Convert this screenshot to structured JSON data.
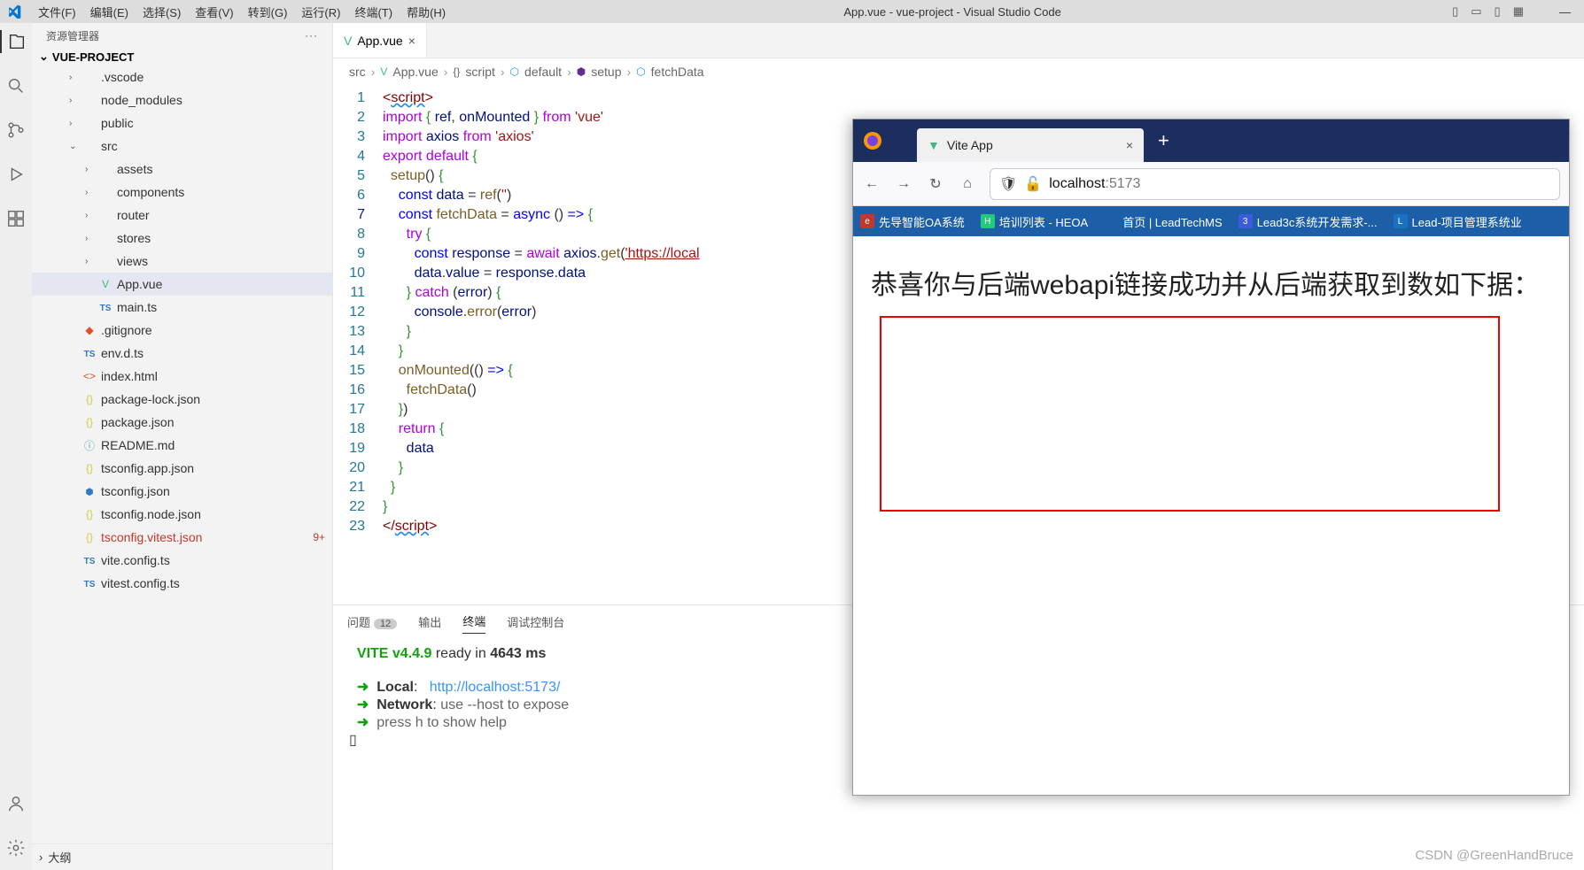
{
  "menubar": {
    "items": [
      "文件(F)",
      "编辑(E)",
      "选择(S)",
      "查看(V)",
      "转到(G)",
      "运行(R)",
      "终端(T)",
      "帮助(H)"
    ],
    "title": "App.vue - vue-project - Visual Studio Code"
  },
  "sidebar": {
    "header": "资源管理器",
    "project": "VUE-PROJECT",
    "outline": "大纲",
    "items": [
      {
        "type": "folder",
        "depth": 1,
        "name": ".vscode",
        "open": false
      },
      {
        "type": "folder",
        "depth": 1,
        "name": "node_modules",
        "open": false
      },
      {
        "type": "folder",
        "depth": 1,
        "name": "public",
        "open": false
      },
      {
        "type": "folder",
        "depth": 1,
        "name": "src",
        "open": true
      },
      {
        "type": "folder",
        "depth": 2,
        "name": "assets",
        "open": false
      },
      {
        "type": "folder",
        "depth": 2,
        "name": "components",
        "open": false
      },
      {
        "type": "folder",
        "depth": 2,
        "name": "router",
        "open": false
      },
      {
        "type": "folder",
        "depth": 2,
        "name": "stores",
        "open": false
      },
      {
        "type": "folder",
        "depth": 2,
        "name": "views",
        "open": false
      },
      {
        "type": "file",
        "depth": 2,
        "name": "App.vue",
        "icon": "vue",
        "active": true
      },
      {
        "type": "file",
        "depth": 2,
        "name": "main.ts",
        "icon": "ts"
      },
      {
        "type": "file",
        "depth": 1,
        "name": ".gitignore",
        "icon": "git"
      },
      {
        "type": "file",
        "depth": 1,
        "name": "env.d.ts",
        "icon": "ts"
      },
      {
        "type": "file",
        "depth": 1,
        "name": "index.html",
        "icon": "html"
      },
      {
        "type": "file",
        "depth": 1,
        "name": "package-lock.json",
        "icon": "json"
      },
      {
        "type": "file",
        "depth": 1,
        "name": "package.json",
        "icon": "json"
      },
      {
        "type": "file",
        "depth": 1,
        "name": "README.md",
        "icon": "md"
      },
      {
        "type": "file",
        "depth": 1,
        "name": "tsconfig.app.json",
        "icon": "json"
      },
      {
        "type": "file",
        "depth": 1,
        "name": "tsconfig.json",
        "icon": "tscfg"
      },
      {
        "type": "file",
        "depth": 1,
        "name": "tsconfig.node.json",
        "icon": "json"
      },
      {
        "type": "file",
        "depth": 1,
        "name": "tsconfig.vitest.json",
        "icon": "json",
        "red": true,
        "badge": "9+"
      },
      {
        "type": "file",
        "depth": 1,
        "name": "vite.config.ts",
        "icon": "ts"
      },
      {
        "type": "file",
        "depth": 1,
        "name": "vitest.config.ts",
        "icon": "ts"
      }
    ]
  },
  "tab": {
    "name": "App.vue"
  },
  "breadcrumbs": [
    "src",
    "App.vue",
    "script",
    "default",
    "setup",
    "fetchData"
  ],
  "code": {
    "lines": 23,
    "current": 7
  },
  "panel": {
    "tabs": {
      "problems": "问题",
      "problems_count": "12",
      "output": "输出",
      "terminal": "终端",
      "debug": "调试控制台"
    },
    "terminal": {
      "banner_prefix": "VITE",
      "banner_version": "v4.4.9",
      "banner_rest": "  ready in ",
      "banner_ms": "4643 ms",
      "local_label": "Local",
      "local_url": "http://localhost:5173/",
      "network_label": "Network",
      "network_hint": "use --host to expose",
      "help": "press h to show help"
    }
  },
  "browser": {
    "tab_title": "Vite App",
    "url_host": "localhost",
    "url_path": ":5173",
    "bookmarks": [
      "先导智能OA系统",
      "培训列表 - HEOA",
      "首页 | LeadTechMS",
      "Lead3c系统开发需求-...",
      "Lead-项目管理系统业"
    ],
    "content": "恭喜你与后端webapi链接成功并从后端获取到数如下据："
  },
  "watermark": "CSDN @GreenHandBruce"
}
